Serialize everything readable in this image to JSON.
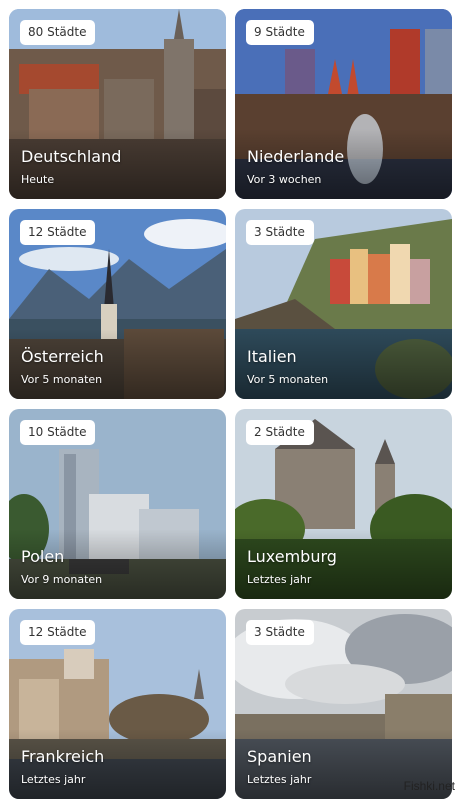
{
  "destinations": [
    {
      "badge": "80 Städte",
      "country": "Deutschland",
      "time": "Heute"
    },
    {
      "badge": "9 Städte",
      "country": "Niederlande",
      "time": "Vor 3 wochen"
    },
    {
      "badge": "12 Städte",
      "country": "Österreich",
      "time": "Vor 5 monaten"
    },
    {
      "badge": "3 Städte",
      "country": "Italien",
      "time": "Vor 5 monaten"
    },
    {
      "badge": "10 Städte",
      "country": "Polen",
      "time": "Vor 9 monaten"
    },
    {
      "badge": "2 Städte",
      "country": "Luxemburg",
      "time": "Letztes jahr"
    },
    {
      "badge": "12 Städte",
      "country": "Frankreich",
      "time": "Letztes jahr"
    },
    {
      "badge": "3 Städte",
      "country": "Spanien",
      "time": "Letztes jahr"
    }
  ],
  "watermark": "Fishki.net"
}
